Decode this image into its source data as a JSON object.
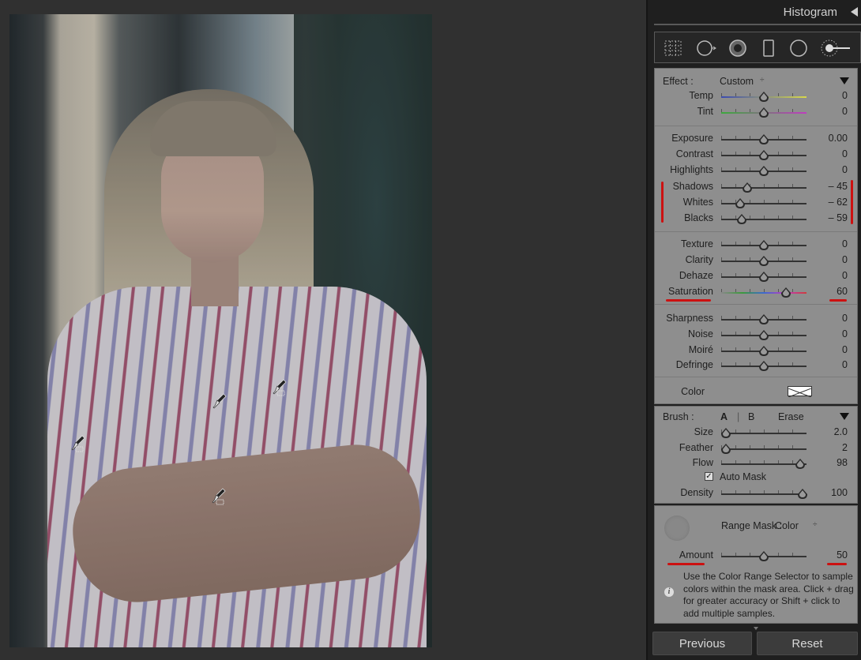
{
  "photo": {
    "description_icons": [
      "color-picker-pin-icon",
      "color-picker-pin-icon",
      "color-picker-pin-icon",
      "color-picker-pin-icon"
    ]
  },
  "histogram": {
    "title": "Histogram",
    "toggle_icon": "triangle-left-icon"
  },
  "tools": [
    {
      "name": "crop-overlay-icon"
    },
    {
      "name": "spot-removal-icon"
    },
    {
      "name": "red-eye-icon"
    },
    {
      "name": "graduated-filter-icon"
    },
    {
      "name": "radial-filter-icon"
    },
    {
      "name": "adjustment-brush-icon"
    }
  ],
  "effect": {
    "label": "Effect :",
    "value": "Custom",
    "arrows": "÷"
  },
  "sliders": {
    "temp": {
      "label": "Temp",
      "value": "0",
      "level": 0.5
    },
    "tint": {
      "label": "Tint",
      "value": "0",
      "level": 0.5
    },
    "exposure": {
      "label": "Exposure",
      "value": "0.00",
      "level": 0.5
    },
    "contrast": {
      "label": "Contrast",
      "value": "0",
      "level": 0.5
    },
    "highlights": {
      "label": "Highlights",
      "value": "0",
      "level": 0.5
    },
    "shadows": {
      "label": "Shadows",
      "value": "– 45",
      "level": 0.31
    },
    "whites": {
      "label": "Whites",
      "value": "– 62",
      "level": 0.22
    },
    "blacks": {
      "label": "Blacks",
      "value": "– 59",
      "level": 0.24
    },
    "texture": {
      "label": "Texture",
      "value": "0",
      "level": 0.5
    },
    "clarity": {
      "label": "Clarity",
      "value": "0",
      "level": 0.5
    },
    "dehaze": {
      "label": "Dehaze",
      "value": "0",
      "level": 0.5
    },
    "saturation": {
      "label": "Saturation",
      "value": "60",
      "level": 0.76
    },
    "sharpness": {
      "label": "Sharpness",
      "value": "0",
      "level": 0.5
    },
    "noise": {
      "label": "Noise",
      "value": "0",
      "level": 0.5
    },
    "moire": {
      "label": "Moiré",
      "value": "0",
      "level": 0.5
    },
    "defringe": {
      "label": "Defringe",
      "value": "0",
      "level": 0.5
    }
  },
  "color": {
    "label": "Color"
  },
  "brush": {
    "label": "Brush :",
    "a": "A",
    "b": "B",
    "erase": "Erase",
    "size": {
      "label": "Size",
      "value": "2.0",
      "level": 0.06
    },
    "feather": {
      "label": "Feather",
      "value": "2",
      "level": 0.06
    },
    "flow": {
      "label": "Flow",
      "value": "98",
      "level": 0.93
    },
    "automask": {
      "label": "Auto Mask",
      "checked": true
    },
    "density": {
      "label": "Density",
      "value": "100",
      "level": 0.95
    }
  },
  "range_mask": {
    "label": "Range Mask :",
    "value": "Color",
    "arrows": "÷",
    "amount": {
      "label": "Amount",
      "value": "50",
      "level": 0.5
    },
    "info": "Use the Color Range Selector to sample colors within the mask area. Click + drag for greater accuracy or Shift + click to add multiple samples."
  },
  "buttons": {
    "previous": "Previous",
    "reset": "Reset"
  },
  "colors": {
    "panel_bg": "#8e8e8e",
    "dark_bg": "#1f1f1f",
    "annotation_red": "#cc1111"
  }
}
